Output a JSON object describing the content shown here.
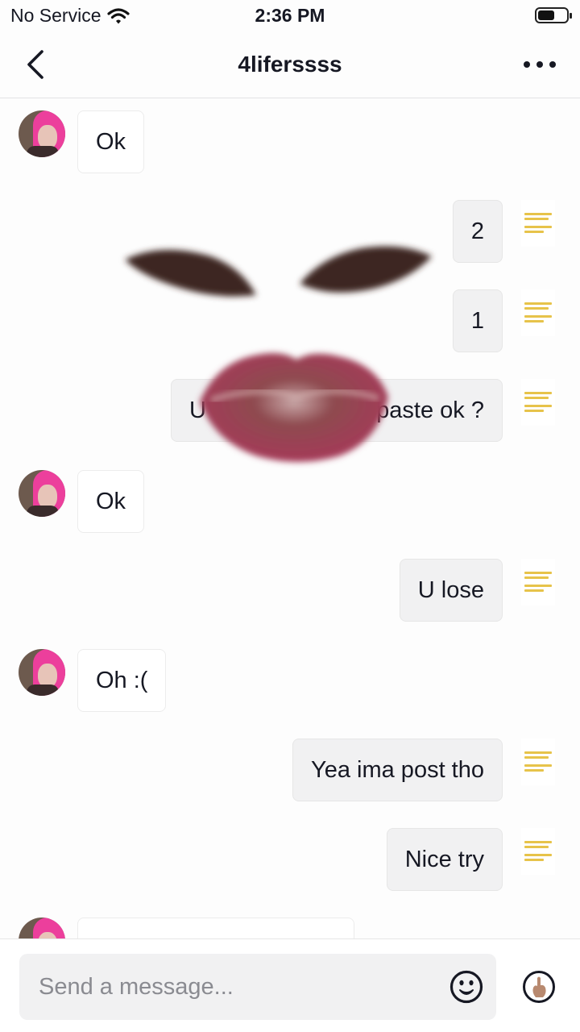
{
  "status_bar": {
    "carrier": "No Service",
    "time": "2:36 PM",
    "wifi_icon": "wifi-icon",
    "battery_level": 0.6
  },
  "header": {
    "title": "4liferssss",
    "back_icon": "chevron-left-icon",
    "more_icon": "more-horizontal-icon"
  },
  "messages": [
    {
      "side": "in",
      "text": "Ok"
    },
    {
      "side": "out",
      "text": "2"
    },
    {
      "side": "out",
      "text": "1"
    },
    {
      "side": "out",
      "text": "U",
      "text_end": "paste ok ?"
    },
    {
      "side": "in",
      "text": "Ok"
    },
    {
      "side": "out",
      "text": "U lose"
    },
    {
      "side": "in",
      "text": "Oh :("
    },
    {
      "side": "out",
      "text": "Yea ima post tho"
    },
    {
      "side": "out",
      "text": "Nice try"
    },
    {
      "side": "in",
      "text": ""
    }
  ],
  "composer": {
    "placeholder": "Send a message...",
    "emoji_icon": "smiley-icon",
    "send_icon": "finger-record-icon"
  },
  "colors": {
    "hair_pink": "#ec3f9c",
    "lip": "#a23a55",
    "brow": "#3e2522"
  }
}
